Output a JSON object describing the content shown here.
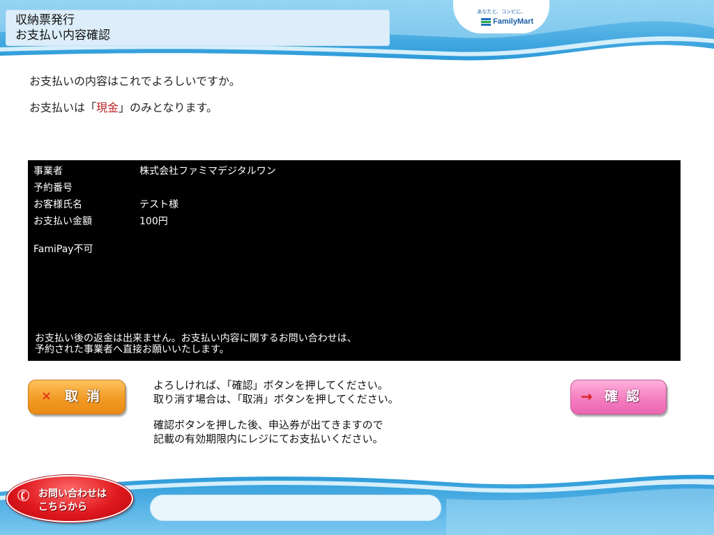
{
  "header": {
    "title_line1": "収納票発行",
    "title_line2": "お支払い内容確認",
    "logo_tagline": "あなたと、コンビに、",
    "logo_text": "FamilyMart",
    "colors": {
      "wave": "#3aa7e0",
      "title_box": "#ddeefa"
    }
  },
  "message": {
    "line1": "お支払いの内容はこれでよろしいですか。",
    "line2_prefix": "お支払いは「",
    "line2_highlight": "現金",
    "line2_suffix": "」のみとなります。",
    "highlight_color": "#c0282a"
  },
  "details": {
    "rows": [
      {
        "label": "事業者",
        "value": "株式会社ファミマデジタルワン"
      },
      {
        "label": "予約番号",
        "value": ""
      },
      {
        "label": "お客様氏名",
        "value": "テスト様"
      },
      {
        "label": "お支払い金額",
        "value": "100円"
      }
    ],
    "famipay_note": "FamiPay不可",
    "notice_line1": "お支払い後の返金は出来ません。お支払い内容に関するお問い合わせは、",
    "notice_line2": "予約された事業者へ直接お願いいたします。"
  },
  "buttons": {
    "cancel_icon": "×",
    "cancel_label": "取消",
    "confirm_icon": "→",
    "confirm_label": "確認",
    "cancel_color": "#f29a25",
    "confirm_color": "#f47ec0"
  },
  "instructions": {
    "line1": "よろしければ、「確認」ボタンを押してください。",
    "line2": "取り消す場合は、「取消」ボタンを押してください。",
    "line3": "確認ボタンを押した後、申込券が出てきますので",
    "line4": "記載の有効期限内にレジにてお支払いください。"
  },
  "footer": {
    "contact_line1": "お問い合わせは",
    "contact_line2": "こちらから",
    "contact_icon": "phone-icon"
  }
}
